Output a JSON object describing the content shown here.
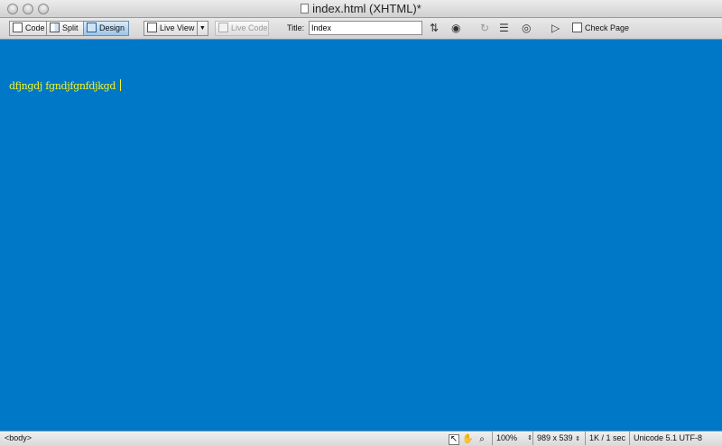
{
  "window": {
    "title": "index.html (XHTML)*"
  },
  "toolbar": {
    "code_label": "Code",
    "split_label": "Split",
    "design_label": "Design",
    "live_view_label": "Live View",
    "live_code_label": "Live Code",
    "title_label": "Title:",
    "title_value": "Index",
    "check_page_label": "Check Page"
  },
  "canvas": {
    "background_color": "#0078c8",
    "text": "dfjngdj fgndjfgnfdjkgd",
    "text_color": "#f6f622"
  },
  "statusbar": {
    "tag_selector": "<body>",
    "zoom": "100%",
    "window_size": "989 x 539",
    "download_stat": "1K / 1 sec",
    "encoding": "Unicode 5.1 UTF-8"
  }
}
